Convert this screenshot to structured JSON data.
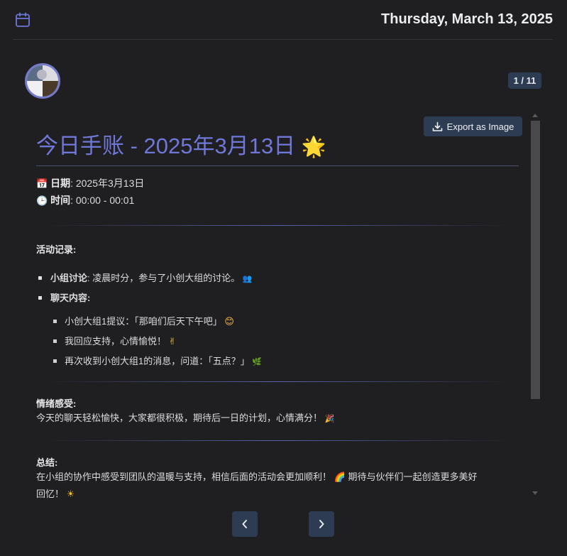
{
  "header": {
    "date": "Thursday, March 13, 2025",
    "calendar_icon": "calendar-icon"
  },
  "pager": {
    "label": "1 / 11"
  },
  "toolbar": {
    "export_label": "Export as Image",
    "export_icon": "download-icon"
  },
  "journal": {
    "title": "今日手账 - 2025年3月13日",
    "title_emoji": "🌟",
    "date_emoji": "📅",
    "date_label": "日期",
    "date_value": ": 2025年3月13日",
    "time_emoji": "🕒",
    "time_label": "时间",
    "time_value": ": 00:00 - 00:01",
    "activity_title": "活动记录:",
    "activity_items": {
      "discussion_label": "小组讨论",
      "discussion_text": ": 凌晨时分，参与了小创大组的讨论。",
      "discussion_emoji": "👥",
      "chat_label": "聊天内容:"
    },
    "chat_items": [
      {
        "text": "小创大组1提议：「那咱们后天下午吧」",
        "emoji": "😊"
      },
      {
        "text": "我回应支持，心情愉悦！",
        "emoji": "✌"
      },
      {
        "text": "再次收到小创大组1的消息，问道：「五点？」",
        "emoji": "🌿"
      }
    ],
    "mood_title": "情绪感受:",
    "mood_text": "今天的聊天轻松愉快，大家都很积极，期待后一日的计划，心情满分！",
    "mood_emoji": "🎉",
    "summary_title": "总结:",
    "summary_text_1": "在小组的协作中感受到团队的温暖与支持，相信后面的活动会更加顺利！",
    "summary_emoji_1": "🌈",
    "summary_text_2": " 期待与伙伴们一起创造更多美好",
    "summary_text_3": "回忆！",
    "summary_emoji_2": "☀"
  },
  "navigation": {
    "prev_icon": "chevron-left-icon",
    "next_icon": "chevron-right-icon"
  },
  "colors": {
    "accent": "#6f78d8",
    "button_bg": "#2d3c52",
    "background": "#1f1f21"
  }
}
